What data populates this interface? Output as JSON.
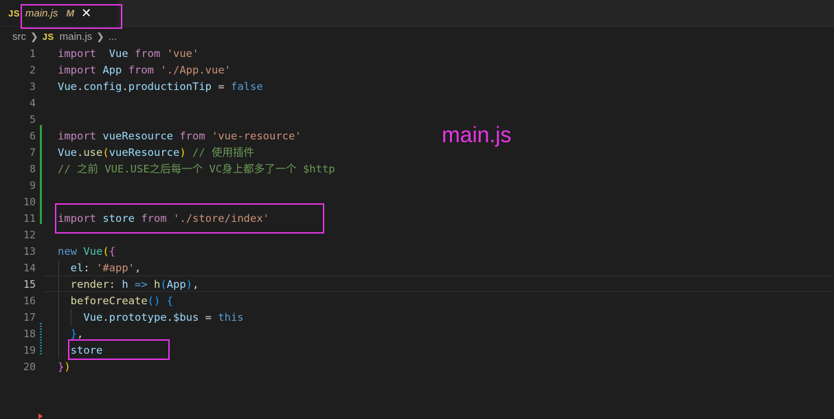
{
  "tab": {
    "icon_label": "JS",
    "title": "main.js",
    "modified_badge": "M",
    "close_glyph": "✕"
  },
  "breadcrumb": {
    "folder": "src",
    "file_icon_label": "JS",
    "file": "main.js",
    "more": "..."
  },
  "annotation": "main.js",
  "colors": {
    "annotation": "#e536e5",
    "added_line": "#2ea043",
    "modified_line": "#1b81a8"
  },
  "code": [
    {
      "n": "1",
      "tokens": [
        [
          "kw",
          "import"
        ],
        [
          "",
          "  "
        ],
        [
          "var",
          "Vue"
        ],
        [
          "",
          " "
        ],
        [
          "kw",
          "from"
        ],
        [
          "",
          " "
        ],
        [
          "str",
          "'vue'"
        ]
      ]
    },
    {
      "n": "2",
      "tokens": [
        [
          "kw",
          "import"
        ],
        [
          "",
          " "
        ],
        [
          "var",
          "App"
        ],
        [
          "",
          " "
        ],
        [
          "kw",
          "from"
        ],
        [
          "",
          " "
        ],
        [
          "str",
          "'./App.vue'"
        ]
      ]
    },
    {
      "n": "3",
      "tokens": [
        [
          "var",
          "Vue"
        ],
        [
          "op",
          "."
        ],
        [
          "var",
          "config"
        ],
        [
          "op",
          "."
        ],
        [
          "var",
          "productionTip"
        ],
        [
          "op",
          " = "
        ],
        [
          "blue",
          "false"
        ]
      ]
    },
    {
      "n": "4",
      "tokens": []
    },
    {
      "n": "5",
      "tokens": []
    },
    {
      "n": "6",
      "tokens": [
        [
          "kw",
          "import"
        ],
        [
          "",
          " "
        ],
        [
          "var",
          "vueResource"
        ],
        [
          "",
          " "
        ],
        [
          "kw",
          "from"
        ],
        [
          "",
          " "
        ],
        [
          "str",
          "'vue-resource'"
        ]
      ]
    },
    {
      "n": "7",
      "tokens": [
        [
          "var",
          "Vue"
        ],
        [
          "op",
          "."
        ],
        [
          "fn",
          "use"
        ],
        [
          "br1",
          "("
        ],
        [
          "var",
          "vueResource"
        ],
        [
          "br1",
          ")"
        ],
        [
          "",
          " "
        ],
        [
          "cmt",
          "// 使用插件"
        ]
      ]
    },
    {
      "n": "8",
      "tokens": [
        [
          "cmt",
          "// 之前 VUE.USE之后每一个 VC身上都多了一个 $http"
        ]
      ]
    },
    {
      "n": "9",
      "tokens": []
    },
    {
      "n": "10",
      "tokens": []
    },
    {
      "n": "11",
      "tokens": [
        [
          "kw",
          "import"
        ],
        [
          "",
          " "
        ],
        [
          "var",
          "store"
        ],
        [
          "",
          " "
        ],
        [
          "kw",
          "from"
        ],
        [
          "",
          " "
        ],
        [
          "str",
          "'./store/index'"
        ]
      ]
    },
    {
      "n": "12",
      "tokens": []
    },
    {
      "n": "13",
      "tokens": [
        [
          "blue",
          "new"
        ],
        [
          "",
          " "
        ],
        [
          "cls",
          "Vue"
        ],
        [
          "br1",
          "("
        ],
        [
          "br2",
          "{"
        ]
      ]
    },
    {
      "n": "14",
      "tokens": [
        [
          "",
          "  "
        ],
        [
          "var",
          "el"
        ],
        [
          "op",
          ": "
        ],
        [
          "str",
          "'#app'"
        ],
        [
          "op",
          ","
        ]
      ]
    },
    {
      "n": "15",
      "tokens": [
        [
          "",
          "  "
        ],
        [
          "fn",
          "render"
        ],
        [
          "op",
          ": "
        ],
        [
          "var",
          "h"
        ],
        [
          "op",
          " "
        ],
        [
          "blue",
          "=>"
        ],
        [
          "op",
          " "
        ],
        [
          "fn",
          "h"
        ],
        [
          "br3",
          "("
        ],
        [
          "var",
          "App"
        ],
        [
          "br3",
          ")"
        ],
        [
          "op",
          ","
        ]
      ]
    },
    {
      "n": "16",
      "tokens": [
        [
          "",
          "  "
        ],
        [
          "fn",
          "beforeCreate"
        ],
        [
          "br3",
          "()"
        ],
        [
          "op",
          " "
        ],
        [
          "br3",
          "{"
        ]
      ]
    },
    {
      "n": "17",
      "tokens": [
        [
          "",
          "    "
        ],
        [
          "var",
          "Vue"
        ],
        [
          "op",
          "."
        ],
        [
          "var",
          "prototype"
        ],
        [
          "op",
          "."
        ],
        [
          "var",
          "$bus"
        ],
        [
          "op",
          " = "
        ],
        [
          "blue",
          "this"
        ]
      ]
    },
    {
      "n": "18",
      "tokens": [
        [
          "",
          "  "
        ],
        [
          "br3",
          "}"
        ],
        [
          "op",
          ","
        ]
      ]
    },
    {
      "n": "19",
      "tokens": [
        [
          "",
          "  "
        ],
        [
          "var",
          "store"
        ]
      ]
    },
    {
      "n": "20",
      "tokens": [
        [
          "br2",
          "}"
        ],
        [
          "br1",
          ")"
        ]
      ]
    }
  ]
}
